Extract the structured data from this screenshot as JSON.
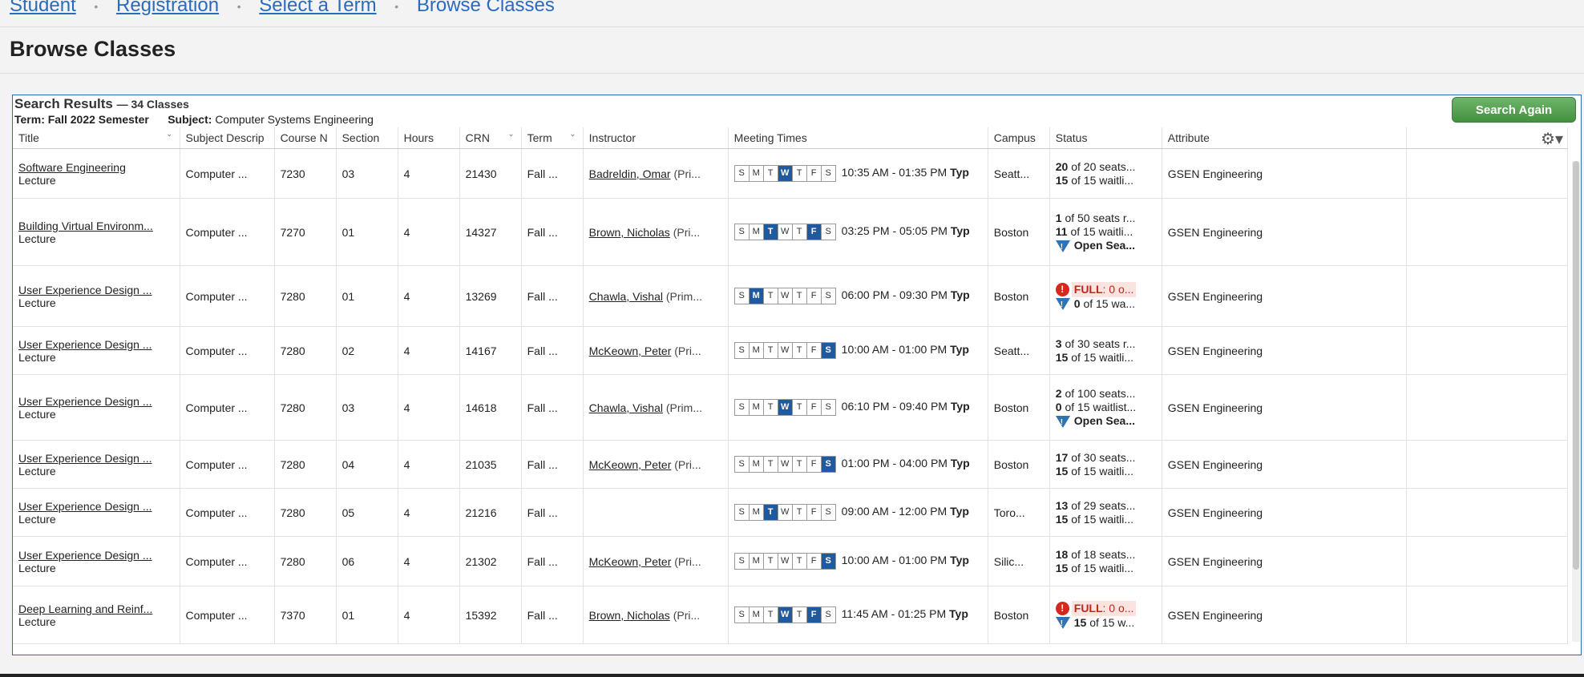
{
  "breadcrumb": {
    "items": [
      "Student",
      "Registration",
      "Select a Term"
    ],
    "current": "Browse Classes",
    "separator": "•"
  },
  "page_title": "Browse Classes",
  "results": {
    "title": "Search Results",
    "count": "— 34 Classes",
    "term_label": "Term:",
    "term_value": "Fall 2022 Semester",
    "subject_label": "Subject:",
    "subject_value": "Computer Systems Engineering",
    "search_again_label": "Search Again"
  },
  "columns": [
    "Title",
    "Subject Descrip",
    "Course N",
    "Section",
    "Hours",
    "CRN",
    "Term",
    "Instructor",
    "Meeting Times",
    "Campus",
    "Status",
    "Attribute"
  ],
  "day_letters": [
    "S",
    "M",
    "T",
    "W",
    "T",
    "F",
    "S"
  ],
  "rows": [
    {
      "title": "Software Engineering",
      "schedule": "Lecture",
      "subject": "Computer ...",
      "course": "7230",
      "section": "03",
      "hours": "4",
      "crn": "21430",
      "term": "Fall ...",
      "instructor": "Badreldin, Omar",
      "role": "(Pri...",
      "days": [
        0,
        0,
        0,
        1,
        0,
        0,
        0
      ],
      "time": "10:35 AM - 01:35 PM",
      "typ": "Typ",
      "campus": "Seatt...",
      "status1": "20",
      "status1_text": " of 20 seats...",
      "status2": "15",
      "status2_text": " of 15 waitli...",
      "status3": "",
      "attribute": "GSEN Engineering"
    },
    {
      "title": "Building Virtual Environm...",
      "schedule": "Lecture",
      "subject": "Computer ...",
      "course": "7270",
      "section": "01",
      "hours": "4",
      "crn": "14327",
      "term": "Fall ...",
      "instructor": "Brown, Nicholas",
      "role": "(Pri...",
      "days": [
        0,
        0,
        1,
        0,
        0,
        1,
        0
      ],
      "time": "03:25 PM - 05:05 PM",
      "typ": "Typ",
      "campus": "Boston",
      "status1": "1",
      "status1_text": " of 50 seats r...",
      "status2": "11",
      "status2_text": " of 15 waitli...",
      "status3": "Open Sea...",
      "attribute": "GSEN Engineering"
    },
    {
      "title": "User Experience Design ...",
      "schedule": "Lecture",
      "subject": "Computer ...",
      "course": "7280",
      "section": "01",
      "hours": "4",
      "crn": "13269",
      "term": "Fall ...",
      "instructor": "Chawla, Vishal",
      "role": "(Prim...",
      "days": [
        0,
        1,
        0,
        0,
        0,
        0,
        0
      ],
      "time": "06:00 PM - 09:30 PM",
      "typ": "Typ",
      "campus": "Boston",
      "full": "FULL",
      "full_text": ": 0 o...",
      "status2": "0",
      "status2_text": " of 15 wa...",
      "attribute": "GSEN Engineering"
    },
    {
      "title": "User Experience Design ...",
      "schedule": "Lecture",
      "subject": "Computer ...",
      "course": "7280",
      "section": "02",
      "hours": "4",
      "crn": "14167",
      "term": "Fall ...",
      "instructor": "McKeown, Peter",
      "role": "(Pri...",
      "days": [
        0,
        0,
        0,
        0,
        0,
        0,
        1
      ],
      "time": "10:00 AM - 01:00 PM",
      "typ": "Typ",
      "campus": "Seatt...",
      "status1": "3",
      "status1_text": " of 30 seats r...",
      "status2": "15",
      "status2_text": " of 15 waitli...",
      "status3": "",
      "attribute": "GSEN Engineering"
    },
    {
      "title": "User Experience Design ...",
      "schedule": "Lecture",
      "subject": "Computer ...",
      "course": "7280",
      "section": "03",
      "hours": "4",
      "crn": "14618",
      "term": "Fall ...",
      "instructor": "Chawla, Vishal",
      "role": "(Prim...",
      "days": [
        0,
        0,
        0,
        1,
        0,
        0,
        0
      ],
      "time": "06:10 PM - 09:40 PM",
      "typ": "Typ",
      "campus": "Boston",
      "status1": "2",
      "status1_text": " of 100 seats...",
      "status2": "0",
      "status2_text": " of 15 waitlist...",
      "status3": "Open Sea...",
      "attribute": "GSEN Engineering"
    },
    {
      "title": "User Experience Design ...",
      "schedule": "Lecture",
      "subject": "Computer ...",
      "course": "7280",
      "section": "04",
      "hours": "4",
      "crn": "21035",
      "term": "Fall ...",
      "instructor": "McKeown, Peter",
      "role": "(Pri...",
      "days": [
        0,
        0,
        0,
        0,
        0,
        0,
        1
      ],
      "time": "01:00 PM - 04:00 PM",
      "typ": "Typ",
      "campus": "Boston",
      "status1": "17",
      "status1_text": " of 30 seats...",
      "status2": "15",
      "status2_text": " of 15 waitli...",
      "status3": "",
      "attribute": "GSEN Engineering"
    },
    {
      "title": "User Experience Design ...",
      "schedule": "Lecture",
      "subject": "Computer ...",
      "course": "7280",
      "section": "05",
      "hours": "4",
      "crn": "21216",
      "term": "Fall ...",
      "instructor": "",
      "role": "",
      "days": [
        0,
        0,
        1,
        0,
        0,
        0,
        0
      ],
      "time": "09:00 AM - 12:00 PM",
      "typ": "Typ",
      "campus": "Toro...",
      "status1": "13",
      "status1_text": " of 29 seats...",
      "status2": "15",
      "status2_text": " of 15 waitli...",
      "status3": "",
      "attribute": "GSEN Engineering"
    },
    {
      "title": "User Experience Design ...",
      "schedule": "Lecture",
      "subject": "Computer ...",
      "course": "7280",
      "section": "06",
      "hours": "4",
      "crn": "21302",
      "term": "Fall ...",
      "instructor": "McKeown, Peter",
      "role": "(Pri...",
      "days": [
        0,
        0,
        0,
        0,
        0,
        0,
        1
      ],
      "time": "10:00 AM - 01:00 PM",
      "typ": "Typ",
      "campus": "Silic...",
      "status1": "18",
      "status1_text": " of 18 seats...",
      "status2": "15",
      "status2_text": " of 15 waitli...",
      "status3": "",
      "attribute": "GSEN Engineering"
    },
    {
      "title": "Deep Learning and Reinf...",
      "schedule": "Lecture",
      "subject": "Computer ...",
      "course": "7370",
      "section": "01",
      "hours": "4",
      "crn": "15392",
      "term": "Fall ...",
      "instructor": "Brown, Nicholas",
      "role": "(Pri...",
      "days": [
        0,
        0,
        0,
        1,
        0,
        1,
        0
      ],
      "time": "11:45 AM - 01:25 PM",
      "typ": "Typ",
      "campus": "Boston",
      "full": "FULL",
      "full_text": ": 0 o...",
      "status2": "15",
      "status2_text": " of 15 w...",
      "attribute": "GSEN Engineering"
    }
  ]
}
